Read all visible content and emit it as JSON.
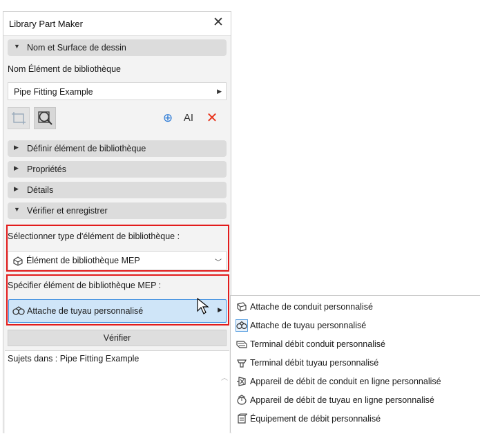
{
  "window": {
    "title": "Library Part Maker",
    "close_glyph": "✕"
  },
  "sections": {
    "nom_surface": {
      "label": "Nom et Surface de dessin",
      "expanded": true
    },
    "definir": {
      "label": "Définir élément de bibliothèque",
      "expanded": false
    },
    "proprietes": {
      "label": "Propriétés",
      "expanded": false
    },
    "details": {
      "label": "Détails",
      "expanded": false
    },
    "verifier": {
      "label": "Vérifier et enregistrer",
      "expanded": true
    }
  },
  "name_field": {
    "label": "Nom Élément de bibliothèque",
    "value": "Pipe Fitting Example"
  },
  "toolbar": {
    "icons": [
      "crop-frame-icon",
      "zoom-lens-icon",
      "add-circle-icon",
      "text-style-icon",
      "delete-x-icon"
    ],
    "text_icon_glyph": "AI",
    "delete_glyph": "✕",
    "add_glyph": "⊕"
  },
  "type_select": {
    "label": "Sélectionner type d'élément de bibliothèque :",
    "value": "Élément de bibliothèque MEP"
  },
  "mep_select": {
    "label": "Spécifier élément de bibliothèque MEP :",
    "value": "Attache de tuyau personnalisé"
  },
  "verify_button": {
    "label": "Vérifier"
  },
  "results": {
    "line": "Sujets dans : Pipe Fitting Example"
  },
  "menu": {
    "items": [
      {
        "label": "Attache de conduit personnalisé",
        "icon": "duct-fitting-icon",
        "selected": false
      },
      {
        "label": "Attache de tuyau personnalisé",
        "icon": "pipe-fitting-icon",
        "selected": true
      },
      {
        "label": "Terminal débit conduit personnalisé",
        "icon": "duct-terminal-icon",
        "selected": false
      },
      {
        "label": "Terminal débit tuyau personnalisé",
        "icon": "pipe-terminal-icon",
        "selected": false
      },
      {
        "label": "Appareil de débit de conduit en ligne personnalisé",
        "icon": "duct-inline-device-icon",
        "selected": false
      },
      {
        "label": "Appareil de débit de tuyau en ligne personnalisé",
        "icon": "pipe-inline-device-icon",
        "selected": false
      },
      {
        "label": "Équipement de débit personnalisé",
        "icon": "flow-equipment-icon",
        "selected": false
      }
    ]
  },
  "colors": {
    "highlight": "#e21b1b",
    "selection": "#cfe5f8",
    "selection_border": "#3c8ee0",
    "accent_blue": "#2b7ad6",
    "delete_red": "#e8361e"
  }
}
